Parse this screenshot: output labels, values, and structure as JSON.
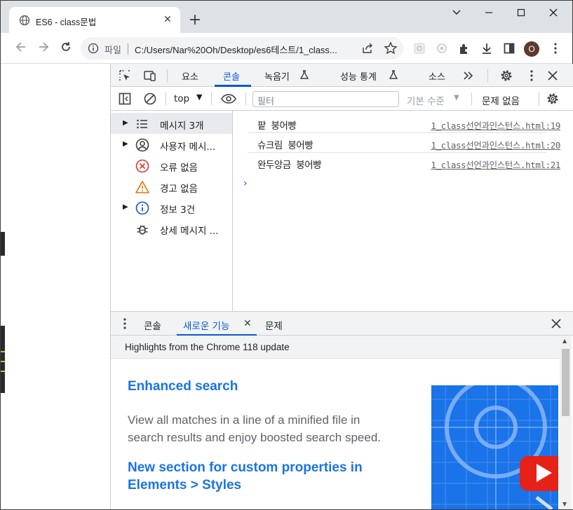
{
  "browser": {
    "tab_title": "ES6 - class문법",
    "address_scheme": "파일",
    "address_url": "C:/Users/Nar%20Oh/Desktop/es6테스트/1_class...",
    "avatar_letter": "O"
  },
  "devtools": {
    "tabs": [
      "요소",
      "콘솔",
      "녹음기",
      "성능 통계",
      "소스"
    ],
    "active_tab": "콘솔",
    "console_toolbar": {
      "context": "top",
      "filter_placeholder": "필터",
      "levels": "기본 수준",
      "issues": "문제 없음"
    },
    "sidebar": [
      {
        "label": "메시지 3개",
        "icon": "list-icon",
        "expandable": true
      },
      {
        "label": "사용자 메시...",
        "icon": "user-icon",
        "expandable": true
      },
      {
        "label": "오류 없음",
        "icon": "error-icon",
        "expandable": false
      },
      {
        "label": "경고 없음",
        "icon": "warning-icon",
        "expandable": false
      },
      {
        "label": "정보 3건",
        "icon": "info-icon",
        "expandable": true
      },
      {
        "label": "상세 메시지 ...",
        "icon": "bug-icon",
        "expandable": false
      }
    ],
    "messages": [
      {
        "text": "팥 붕어빵",
        "source": "1_class선언과인스턴스.html:19"
      },
      {
        "text": "슈크림 붕어빵",
        "source": "1_class선언과인스턴스.html:20"
      },
      {
        "text": "완두앙금 붕어빵",
        "source": "1_class선언과인스턴스.html:21"
      }
    ],
    "drawer": {
      "tabs": [
        "콘솔",
        "새로운 기능",
        "문제"
      ],
      "active_tab": "새로운 기능",
      "header": "Highlights from the Chrome 118 update",
      "heading1": "Enhanced search",
      "paragraph1": "View all matches in a line of a minified file in search results and enjoy boosted search speed.",
      "heading2": "New section for custom properties in Elements > Styles"
    },
    "colors": {
      "accent": "#0b57d0",
      "heading": "#1a73e8"
    }
  }
}
